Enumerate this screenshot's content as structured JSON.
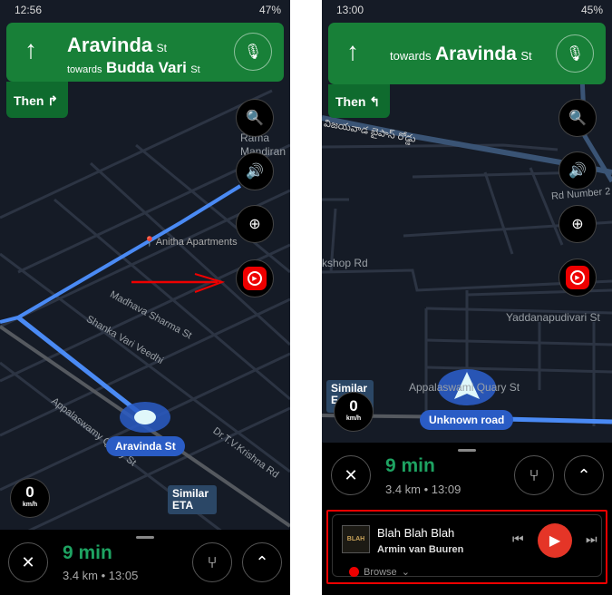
{
  "left": {
    "status": {
      "time": "12:56",
      "battery": "47%"
    },
    "direction": {
      "street": "Aravinda",
      "street_suffix": "St",
      "towards_label": "towards",
      "towards_street": "Budda Vari",
      "towards_suffix": "St"
    },
    "then_label": "Then",
    "map_labels": [
      "Rama",
      "Mandiran",
      "Anitha Apartments",
      "Madhava Sharma St",
      "Shanka Vari Veedhi",
      "Appalaswamy Quary St",
      "Dr.T.V.Krishna Rd"
    ],
    "current_road": "Aravinda St",
    "similar_eta": "Similar ETA",
    "speed": {
      "value": "0",
      "unit": "km/h"
    },
    "trip": {
      "duration": "9 min",
      "distance": "3.4 km",
      "arrival": "13:05"
    }
  },
  "right": {
    "status": {
      "time": "13:00",
      "battery": "45%"
    },
    "direction": {
      "towards_label": "towards",
      "towards_street": "Aravinda",
      "towards_suffix": "St"
    },
    "then_label": "Then",
    "map_labels": [
      "విజయవాడ బైపాస్ రోడ్డు",
      "Rd Number 2",
      "kshop Rd",
      "Yaddanapudivari St",
      "Appalaswami Quary St"
    ],
    "current_road": "Unknown road",
    "similar_eta": "Similar E",
    "speed": {
      "value": "0",
      "unit": "km/h"
    },
    "trip": {
      "duration": "9 min",
      "distance": "3.4 km",
      "arrival": "13:09"
    },
    "media": {
      "title": "Blah Blah Blah",
      "artist": "Armin van Buuren",
      "album_art_text": "BLAH",
      "browse_label": "Browse"
    }
  },
  "colors": {
    "nav_green": "#188038",
    "route_blue": "#4285f4",
    "youtube_red": "#e00000",
    "eta_green": "#1ea362",
    "highlight_red": "#e00000"
  }
}
